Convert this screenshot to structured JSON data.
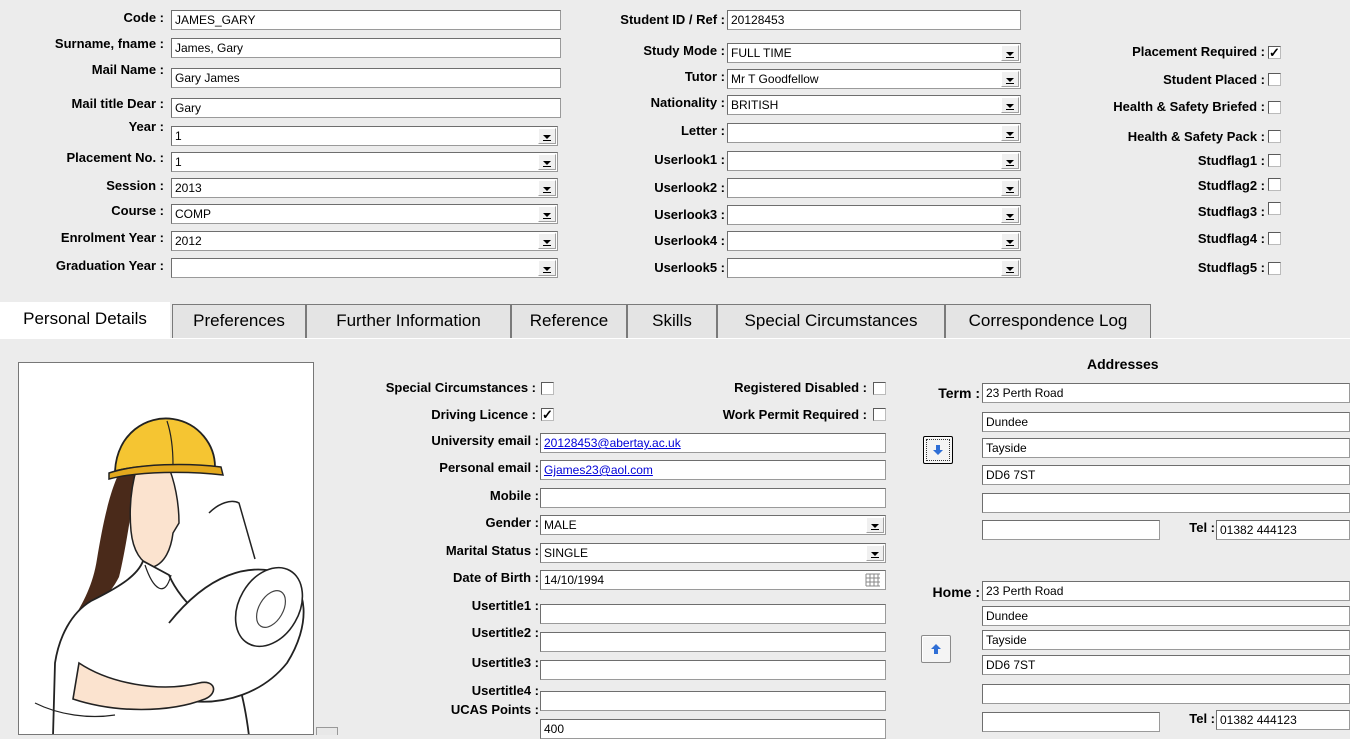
{
  "header": {
    "code": {
      "label": "Code :",
      "value": "JAMES_GARY"
    },
    "surname": {
      "label": "Surname, fname :",
      "value": "James, Gary"
    },
    "mail_name": {
      "label": "Mail Name :",
      "value": "Gary James"
    },
    "mail_title": {
      "label": "Mail title Dear :",
      "value": "Gary"
    },
    "year": {
      "label": "Year :",
      "value": "1"
    },
    "placement_no": {
      "label": "Placement No. :",
      "value": "1"
    },
    "session": {
      "label": "Session :",
      "value": "2013"
    },
    "course": {
      "label": "Course :",
      "value": "COMP"
    },
    "enrolment_year": {
      "label": "Enrolment Year :",
      "value": "2012"
    },
    "graduation_year": {
      "label": "Graduation Year :",
      "value": ""
    },
    "student_id": {
      "label": "Student ID / Ref :",
      "value": "20128453"
    },
    "study_mode": {
      "label": "Study Mode :",
      "value": "FULL TIME"
    },
    "tutor": {
      "label": "Tutor :",
      "value": "Mr T Goodfellow"
    },
    "nationality": {
      "label": "Nationality :",
      "value": "BRITISH"
    },
    "letter": {
      "label": "Letter :",
      "value": ""
    },
    "userlook1": {
      "label": "Userlook1 :",
      "value": ""
    },
    "userlook2": {
      "label": "Userlook2 :",
      "value": ""
    },
    "userlook3": {
      "label": "Userlook3 :",
      "value": ""
    },
    "userlook4": {
      "label": "Userlook4 :",
      "value": ""
    },
    "userlook5": {
      "label": "Userlook5 :",
      "value": ""
    }
  },
  "flags": {
    "placement_required": {
      "label": "Placement Required :",
      "checked": true
    },
    "student_placed": {
      "label": "Student Placed :",
      "checked": false
    },
    "hs_briefed": {
      "label": "Health & Safety  Briefed :",
      "checked": false
    },
    "hs_pack": {
      "label": "Health & Safety Pack :",
      "checked": false
    },
    "studflag1": {
      "label": "Studflag1 :",
      "checked": false
    },
    "studflag2": {
      "label": "Studflag2 :",
      "checked": false
    },
    "studflag3": {
      "label": "Studflag3 :",
      "checked": false
    },
    "studflag4": {
      "label": "Studflag4 :",
      "checked": false
    },
    "studflag5": {
      "label": "Studflag5 :",
      "checked": false
    }
  },
  "tabs": [
    {
      "label": "Personal Details"
    },
    {
      "label": "Preferences"
    },
    {
      "label": "Further Information"
    },
    {
      "label": "Reference"
    },
    {
      "label": "Skills"
    },
    {
      "label": "Special Circumstances"
    },
    {
      "label": "Correspondence Log"
    }
  ],
  "personal": {
    "special_circumstances": {
      "label": "Special Circumstances :",
      "checked": false
    },
    "registered_disabled": {
      "label": "Registered Disabled :",
      "checked": false
    },
    "driving_licence": {
      "label": "Driving Licence :",
      "checked": true
    },
    "work_permit": {
      "label": "Work Permit Required :",
      "checked": false
    },
    "university_email": {
      "label": "University email :",
      "value": "20128453@abertay.ac.uk"
    },
    "personal_email": {
      "label": "Personal email :",
      "value": "Gjames23@aol.com"
    },
    "mobile": {
      "label": "Mobile :",
      "value": ""
    },
    "gender": {
      "label": "Gender :",
      "value": "MALE"
    },
    "marital_status": {
      "label": "Marital Status :",
      "value": "SINGLE"
    },
    "dob": {
      "label": "Date of Birth :",
      "value": "14/10/1994"
    },
    "usertitle1": {
      "label": "Usertitle1 :",
      "value": ""
    },
    "usertitle2": {
      "label": "Usertitle2 :",
      "value": ""
    },
    "usertitle3": {
      "label": "Usertitle3 :",
      "value": ""
    },
    "usertitle4": {
      "label": "Usertitle4 :",
      "value": ""
    },
    "ucas_points": {
      "label": "UCAS Points :",
      "value": "400"
    }
  },
  "addresses": {
    "title": "Addresses",
    "term": {
      "label": "Term :",
      "lines": [
        "23 Perth Road",
        "Dundee",
        "Tayside",
        "DD6 7ST",
        ""
      ],
      "tel_label": "Tel :",
      "tel": "01382 444123"
    },
    "home": {
      "label": "Home :",
      "lines": [
        "23 Perth Road",
        "Dundee",
        "Tayside",
        "DD6 7ST",
        ""
      ],
      "tel_label": "Tel :",
      "tel": "01382 444123"
    }
  },
  "colors": {
    "link": "#0000d8",
    "arrow": "#2f6fd6"
  }
}
